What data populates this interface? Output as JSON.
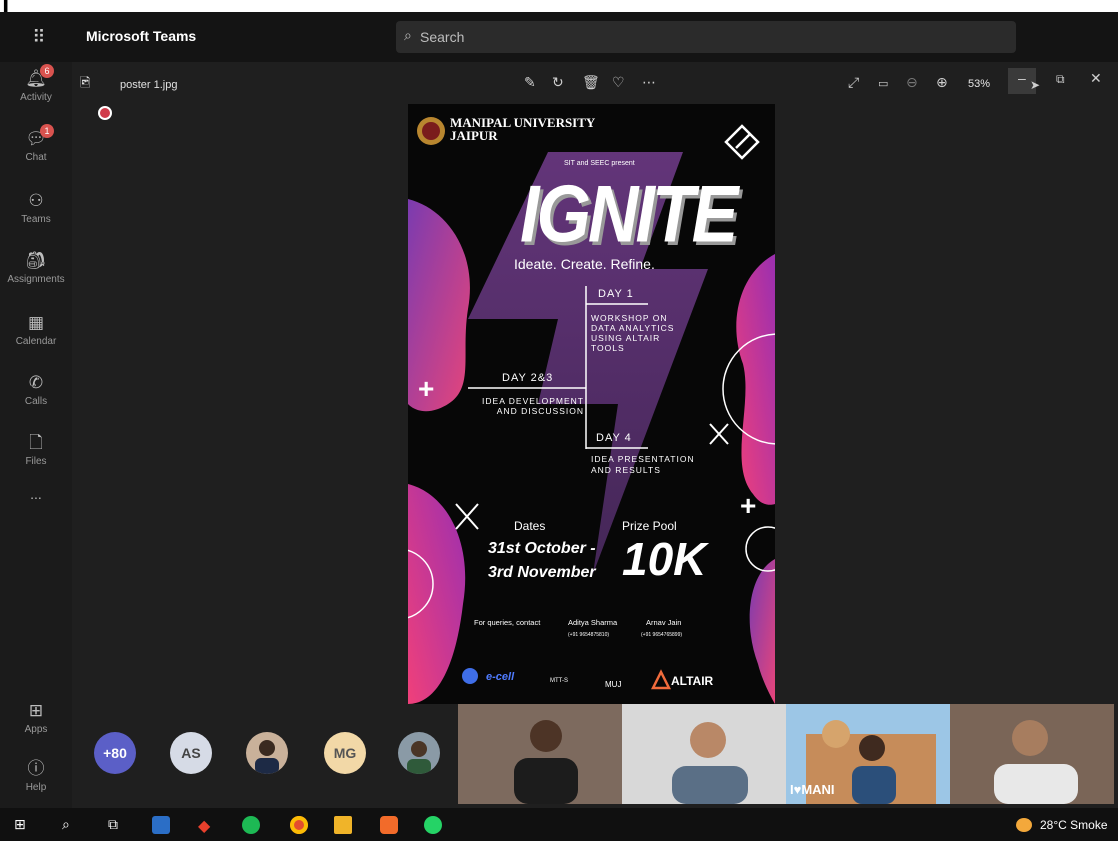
{
  "app": {
    "title": "Microsoft Teams",
    "search_placeholder": "Search"
  },
  "rail": [
    {
      "label": "Activity",
      "icon": "bell-icon",
      "badge": "6"
    },
    {
      "label": "Chat",
      "icon": "chat-icon",
      "badge": "1"
    },
    {
      "label": "Teams",
      "icon": "teams-icon"
    },
    {
      "label": "Assignments",
      "icon": "assignments-icon"
    },
    {
      "label": "Calendar",
      "icon": "calendar-icon"
    },
    {
      "label": "Calls",
      "icon": "phone-icon"
    },
    {
      "label": "Files",
      "icon": "file-icon"
    },
    {
      "label": "...",
      "icon": "more-icon"
    },
    {
      "label": "Apps",
      "icon": "apps-icon"
    },
    {
      "label": "Help",
      "icon": "help-icon"
    }
  ],
  "viewer": {
    "file_name": "poster 1.jpg",
    "zoom": "53%"
  },
  "poster": {
    "university_line1": "MANIPAL UNIVERSITY",
    "university_line2": "JAIPUR",
    "presenters": "SIT and SEEC present",
    "title": "IGNITE",
    "tagline": "Ideate. Create. Refine.",
    "day1_title": "DAY 1",
    "day1_desc": [
      "WORKSHOP ON",
      "DATA ANALYTICS",
      "USING ALTAIR",
      "TOOLS"
    ],
    "day23_title": "DAY 2&3",
    "day23_desc": [
      "IDEA DEVELOPMENT",
      "AND DISCUSSION"
    ],
    "day4_title": "DAY 4",
    "day4_desc": [
      "IDEA  PRESENTATION",
      "AND RESULTS"
    ],
    "dates_label": "Dates",
    "dates_value1": "31st October -",
    "dates_value2": "3rd November",
    "prize_label": "Prize Pool",
    "prize_value": "10K",
    "contact_label": "For queries, contact",
    "contact1_name": "Aditya Sharma",
    "contact1_phone": "(+91 9654875810)",
    "contact2_name": "Arnav Jain",
    "contact2_phone": "(+91 9654765899)",
    "sponsor1": "e-cell",
    "sponsor2": "MTT-S",
    "sponsor3": "MUJ",
    "sponsor4": "ALTAIR"
  },
  "participants": [
    {
      "initials": "+80",
      "color": "#5b5fc7"
    },
    {
      "initials": "AS",
      "color": "#d6dbe6"
    },
    {
      "initials": "MG",
      "color": "#f2d8a7"
    }
  ],
  "video_banner_text": "I♥MANI",
  "taskbar": {
    "weather": "28°C  Smoke"
  }
}
